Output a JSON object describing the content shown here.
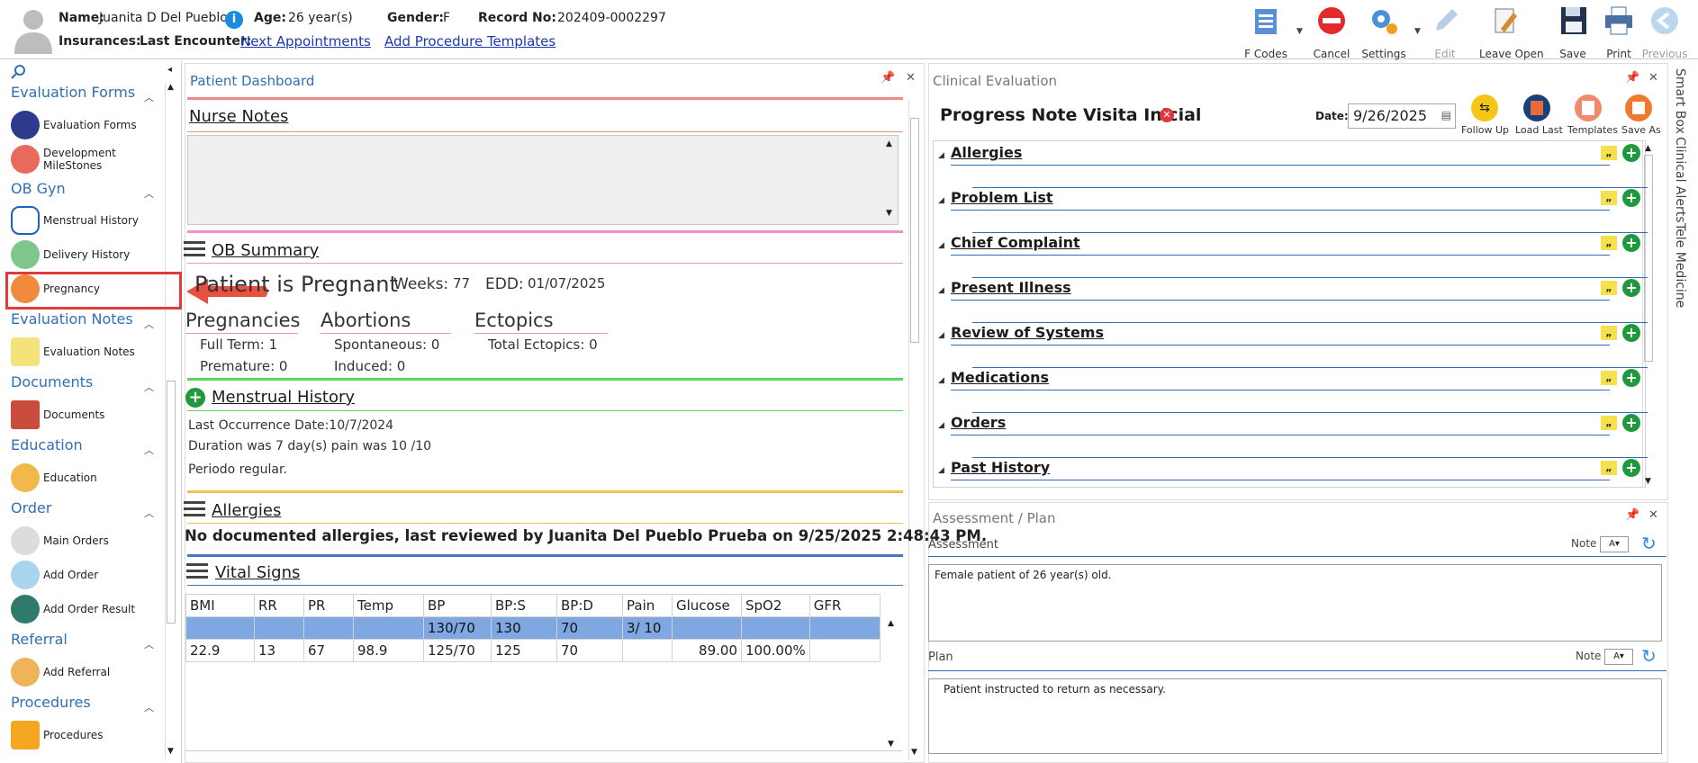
{
  "patient": {
    "name_label": "Name:",
    "name": "Juanita D Del Pueblo",
    "age_label": "Age:",
    "age": "26 year(s)",
    "gender_label": "Gender:",
    "gender": "F",
    "record_label": "Record No:",
    "record": "202409-0002297",
    "insurances_label": "Insurances:",
    "last_encounter_label": "Last Encounter:",
    "next_appointments": "Next Appointments",
    "add_procedure_templates": "Add Procedure Templates"
  },
  "toolbar": {
    "fcodes": "F Codes",
    "cancel": "Cancel",
    "settings": "Settings",
    "edit": "Edit",
    "leave_open": "Leave Open",
    "save": "Save",
    "print": "Print",
    "previous": "Previous"
  },
  "sidebar": {
    "groups": [
      {
        "title": "Evaluation Forms",
        "items": [
          "Evaluation Forms",
          "Development MileStones"
        ]
      },
      {
        "title": "OB Gyn",
        "items": [
          "Menstrual History",
          "Delivery History",
          "Pregnancy"
        ]
      },
      {
        "title": "Evaluation Notes",
        "items": [
          "Evaluation Notes"
        ]
      },
      {
        "title": "Documents",
        "items": [
          "Documents"
        ]
      },
      {
        "title": "Education",
        "items": [
          "Education"
        ]
      },
      {
        "title": "Order",
        "items": [
          "Main Orders",
          "Add Order",
          "Add Order Result"
        ]
      },
      {
        "title": "Referral",
        "items": [
          "Add Referral"
        ]
      },
      {
        "title": "Procedures",
        "items": [
          "Procedures"
        ]
      }
    ]
  },
  "dashboard": {
    "title": "Patient Dashboard",
    "nurse_notes": "Nurse Notes",
    "ob_summary": "OB Summary",
    "pregnant_status": "Patient is Pregnant",
    "weeks_label": "Weeks:",
    "weeks": "77",
    "edd_label": "EDD:",
    "edd": "01/07/2025",
    "pregnancies": "Pregnancies",
    "full_term": "Full Term: 1",
    "premature": "Premature: 0",
    "abortions": "Abortions",
    "spontaneous": "Spontaneous: 0",
    "induced": "Induced: 0",
    "ectopics": "Ectopics",
    "total_ectopics": "Total Ectopics: 0",
    "menstrual_history": "Menstrual History",
    "last_occurrence": "Last Occurrence Date:10/7/2024",
    "duration": "Duration was 7 day(s) pain was 10 /10",
    "periodo": "Periodo regular.",
    "allergies": "Allergies",
    "allergies_text": "No documented allergies, last reviewed by Juanita Del Pueblo Prueba on 9/25/2025 2:48:43 PM.",
    "vital_signs": "Vital Signs",
    "vitals_headers": [
      "BMI",
      "RR",
      "PR",
      "Temp",
      "BP",
      "BP:S",
      "BP:D",
      "Pain",
      "Glucose",
      "SpO2",
      "GFR"
    ],
    "vitals_rows": [
      [
        "",
        "",
        "",
        "",
        "130/70",
        "130",
        "70",
        "3/ 10",
        "",
        "",
        ""
      ],
      [
        "22.9",
        "13",
        "67",
        "98.9",
        "125/70",
        "125",
        "70",
        "",
        "89.00",
        "100.00%",
        ""
      ]
    ]
  },
  "clinical": {
    "title": "Clinical Evaluation",
    "note_title": "Progress Note Visita Inicial",
    "date_label": "Date:",
    "date_value": "9/26/2025",
    "follow_up": "Follow Up",
    "load_last": "Load Last",
    "templates": "Templates",
    "save_as": "Save As",
    "sections": [
      "Allergies",
      "Problem List",
      "Chief Complaint",
      "Present Illness",
      "Review of Systems",
      "Medications",
      "Orders",
      "Past History"
    ]
  },
  "assessment": {
    "title": "Assessment / Plan",
    "assessment_label": "Assessment",
    "note_label": "Note",
    "assessment_text": "Female patient of 26 year(s) old.",
    "plan_label": "Plan",
    "plan_text": "Patient instructed to return as necessary."
  },
  "side_tabs": [
    "Smart Box",
    "Clinical Alerts",
    "Tele Medicine"
  ],
  "colors": {
    "accent": "#2f6fb5",
    "rule_red": "#ee8a8a",
    "rule_pink": "#f48fc4",
    "rule_green": "#5cd65c",
    "rule_yellow": "#f0c050",
    "rule_blue": "#4a74c4",
    "highlight_red": "#e23b3b",
    "row_selected": "#7fa8e3"
  }
}
